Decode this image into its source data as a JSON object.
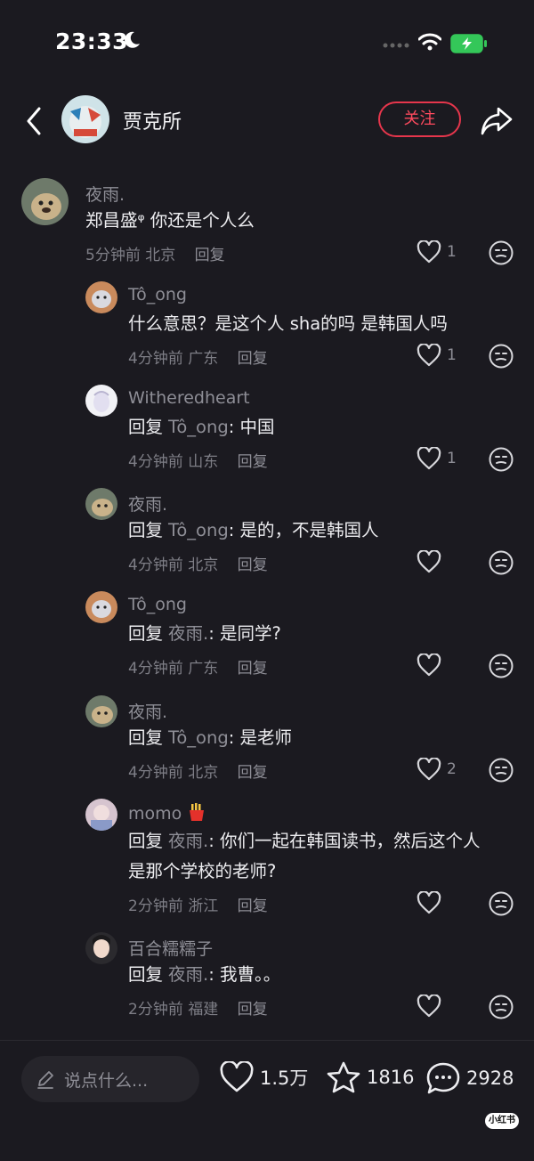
{
  "status_bar": {
    "time": "23:33"
  },
  "header": {
    "author": "贾克所",
    "follow_label": "关注"
  },
  "comments": [
    {
      "name": "夜雨.",
      "text": "郑昌盛ᵠ 你还是个人么",
      "time": "5分钟前",
      "location": "北京",
      "reply_label": "回复",
      "likes": "1"
    },
    {
      "name": "Tô_ong",
      "text": "什么意思？是这个人 sha的吗 是韩国人吗",
      "time": "4分钟前",
      "location": "广东",
      "reply_label": "回复",
      "likes": "1"
    },
    {
      "name": "Witheredheart",
      "prefix": "回复",
      "ref": "Tô_ong",
      "text": ": 中国",
      "time": "4分钟前",
      "location": "山东",
      "reply_label": "回复",
      "likes": "1"
    },
    {
      "name": "夜雨.",
      "prefix": "回复",
      "ref": "Tô_ong",
      "text": ": 是的，不是韩国人",
      "time": "4分钟前",
      "location": "北京",
      "reply_label": "回复",
      "likes": ""
    },
    {
      "name": "Tô_ong",
      "prefix": "回复",
      "ref": "夜雨.",
      "text": ": 是同学?",
      "time": "4分钟前",
      "location": "广东",
      "reply_label": "回复",
      "likes": ""
    },
    {
      "name": "夜雨.",
      "prefix": "回复",
      "ref": "Tô_ong",
      "text": ": 是老师",
      "time": "4分钟前",
      "location": "北京",
      "reply_label": "回复",
      "likes": "2"
    },
    {
      "name": "momo",
      "prefix": "回复",
      "ref": "夜雨.",
      "text": ": 你们一起在韩国读书，然后这个人",
      "text2": "是那个学校的老师?",
      "time": "2分钟前",
      "location": "浙江",
      "reply_label": "回复",
      "likes": ""
    },
    {
      "name": "百合糯糯子",
      "prefix": "回复",
      "ref": "夜雨.",
      "text": ": 我曹。。",
      "time": "2分钟前",
      "location": "福建",
      "reply_label": "回复",
      "likes": ""
    }
  ],
  "bottom_bar": {
    "input_placeholder": "说点什么...",
    "likes": "1.5万",
    "stars": "1816",
    "comments": "2928"
  },
  "watermark": "小红书",
  "colors": {
    "background": "#1b1a20",
    "accent": "#e6364c"
  },
  "icons": [
    "back-icon",
    "share-icon",
    "heart-icon",
    "emoji-icon",
    "pen-icon",
    "star-icon",
    "comment-bubble-icon",
    "moon-icon",
    "wifi-icon",
    "battery-icon"
  ]
}
